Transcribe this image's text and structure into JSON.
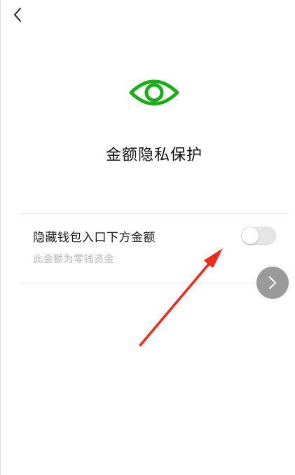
{
  "header": {
    "back_icon": "chevron-left-icon"
  },
  "hero": {
    "icon": "eye-icon",
    "icon_color": "#1aad19",
    "title": "金额隐私保护"
  },
  "setting": {
    "label": "隐藏钱包入口下方金额",
    "description": "此金额为零钱资金",
    "toggle_on": false
  },
  "floating_button": {
    "icon": "chevron-right-icon",
    "color": "#9a9a9a"
  },
  "annotation": {
    "icon": "red-arrow",
    "color": "#f02b1e"
  }
}
